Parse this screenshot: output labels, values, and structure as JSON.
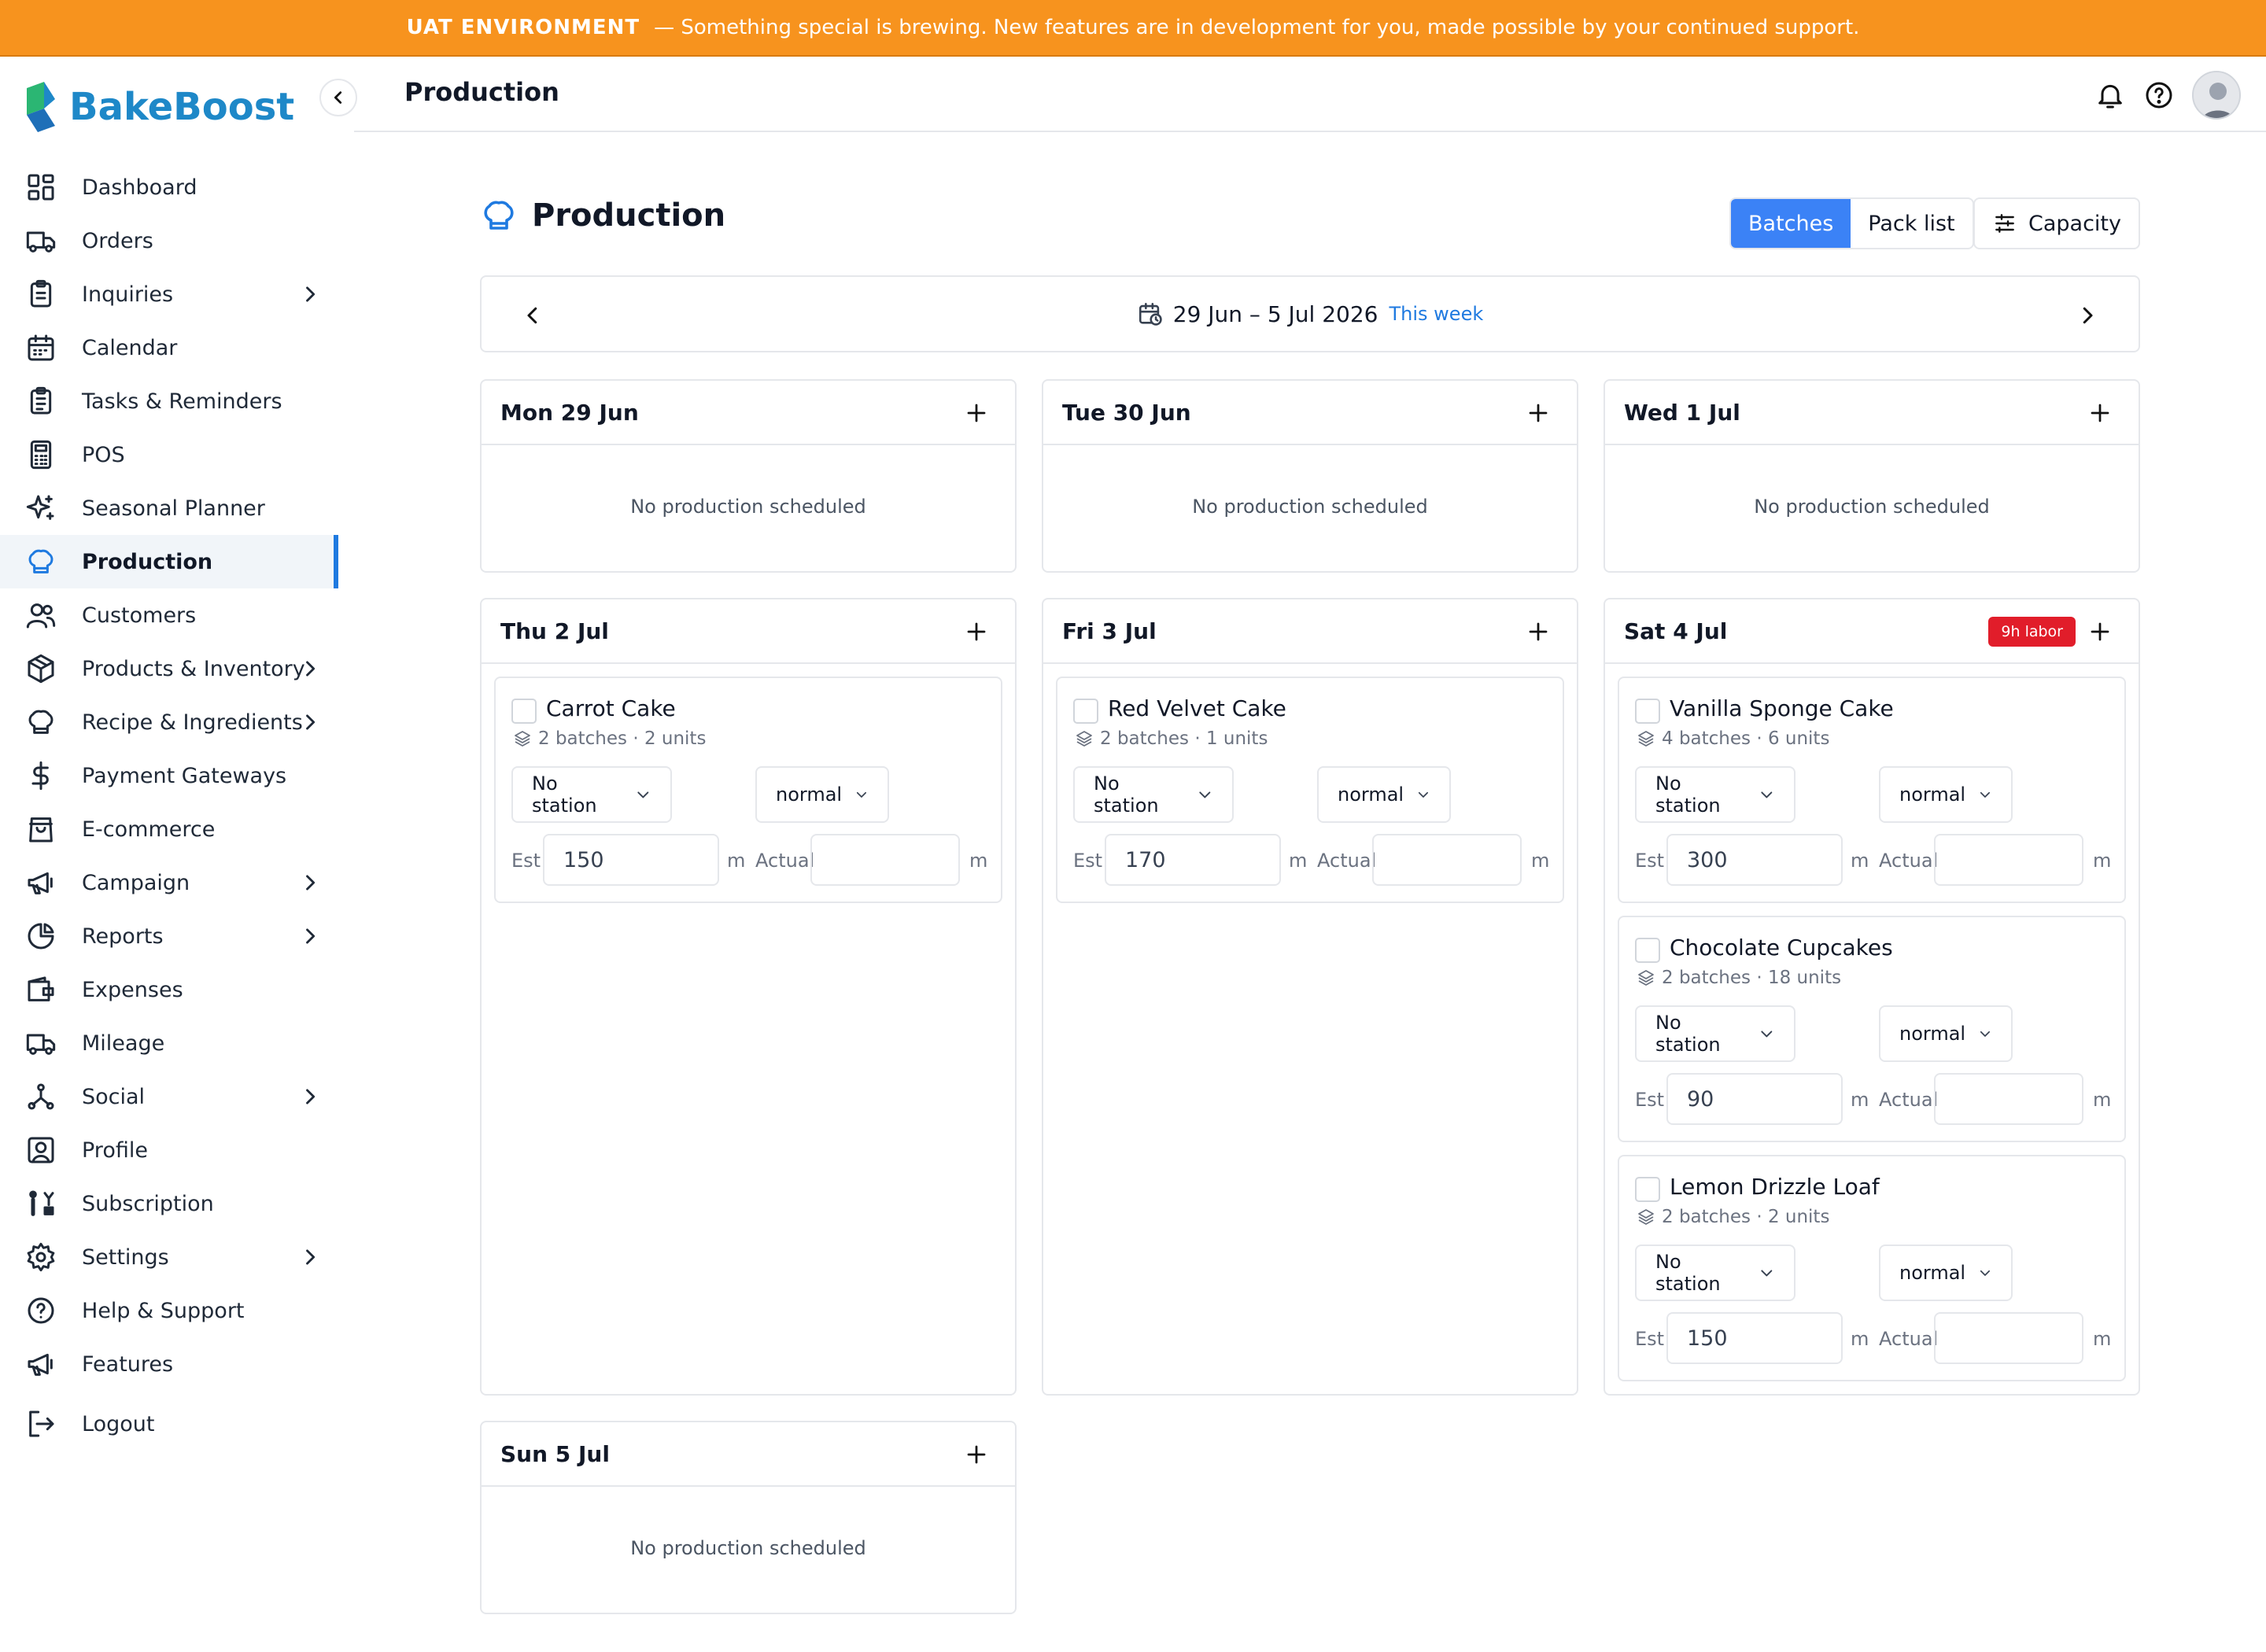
{
  "banner": {
    "env": "UAT ENVIRONMENT",
    "message": "— Something special is brewing. New features are in development for you, made possible by your continued support."
  },
  "brand": {
    "name": "BakeBoost",
    "color": "#1e88c8"
  },
  "sidebar": {
    "items": [
      {
        "label": "Dashboard",
        "icon": "dashboard-icon"
      },
      {
        "label": "Orders",
        "icon": "truck-icon"
      },
      {
        "label": "Inquiries",
        "icon": "clipboard-icon",
        "chevron": true
      },
      {
        "label": "Calendar",
        "icon": "calendar-icon"
      },
      {
        "label": "Tasks & Reminders",
        "icon": "clipboard-list-icon"
      },
      {
        "label": "POS",
        "icon": "calculator-icon"
      },
      {
        "label": "Seasonal Planner",
        "icon": "sparkles-icon"
      },
      {
        "label": "Production",
        "icon": "chef-hat-icon",
        "active": true
      },
      {
        "label": "Customers",
        "icon": "users-icon"
      },
      {
        "label": "Products & Inventory",
        "icon": "package-icon",
        "chevron": true
      },
      {
        "label": "Recipe & Ingredients",
        "icon": "chef-hat-icon",
        "chevron": true
      },
      {
        "label": "Payment Gateways",
        "icon": "dollar-icon"
      },
      {
        "label": "E-commerce",
        "icon": "shopping-bag-icon"
      },
      {
        "label": "Campaign",
        "icon": "megaphone-icon",
        "chevron": true
      },
      {
        "label": "Reports",
        "icon": "pie-chart-icon",
        "chevron": true
      },
      {
        "label": "Expenses",
        "icon": "wallet-icon"
      },
      {
        "label": "Mileage",
        "icon": "truck-icon"
      },
      {
        "label": "Social",
        "icon": "share-icon",
        "chevron": true
      },
      {
        "label": "Profile",
        "icon": "user-square-icon"
      },
      {
        "label": "Subscription",
        "icon": "subscription-icon"
      },
      {
        "label": "Settings",
        "icon": "gear-icon",
        "chevron": true
      },
      {
        "label": "Help & Support",
        "icon": "help-circle-icon"
      },
      {
        "label": "Features",
        "icon": "megaphone-icon"
      },
      {
        "label": "Logout",
        "icon": "logout-icon"
      }
    ]
  },
  "topbar": {
    "title": "Production"
  },
  "main": {
    "title": "Production",
    "tabs": [
      {
        "label": "Batches",
        "active": true
      },
      {
        "label": "Pack list",
        "active": false
      }
    ],
    "capacity_label": "Capacity",
    "week": {
      "range": "29 Jun – 5 Jul 2026",
      "badge": "This week"
    }
  },
  "days": [
    {
      "name": "Mon 29 Jun",
      "empty": "No production scheduled"
    },
    {
      "name": "Tue 30 Jun",
      "empty": "No production scheduled"
    },
    {
      "name": "Wed 1 Jul",
      "empty": "No production scheduled"
    },
    {
      "name": "Thu 2 Jul",
      "items": [
        {
          "name": "Carrot Cake",
          "meta": "2 batches · 2 units",
          "station": "No station",
          "priority": "normal",
          "est": "150",
          "actual": ""
        }
      ]
    },
    {
      "name": "Fri 3 Jul",
      "items": [
        {
          "name": "Red Velvet Cake",
          "meta": "2 batches · 1 units",
          "station": "No station",
          "priority": "normal",
          "est": "170",
          "actual": ""
        }
      ]
    },
    {
      "name": "Sat 4 Jul",
      "labor": "9h labor",
      "items": [
        {
          "name": "Vanilla Sponge Cake",
          "meta": "4 batches · 6 units",
          "station": "No station",
          "priority": "normal",
          "est": "300",
          "actual": ""
        },
        {
          "name": "Chocolate Cupcakes",
          "meta": "2 batches · 18 units",
          "station": "No station",
          "priority": "normal",
          "est": "90",
          "actual": ""
        },
        {
          "name": "Lemon Drizzle Loaf",
          "meta": "2 batches · 2 units",
          "station": "No station",
          "priority": "normal",
          "est": "150",
          "actual": ""
        }
      ]
    },
    {
      "name": "Sun 5 Jul",
      "empty": "No production scheduled"
    }
  ],
  "labels": {
    "est": "Est",
    "actual": "Actual",
    "unit": "m"
  },
  "colors": {
    "banner": "#f7931e",
    "accent": "#3b82f6",
    "labor": "#e11d2a"
  }
}
